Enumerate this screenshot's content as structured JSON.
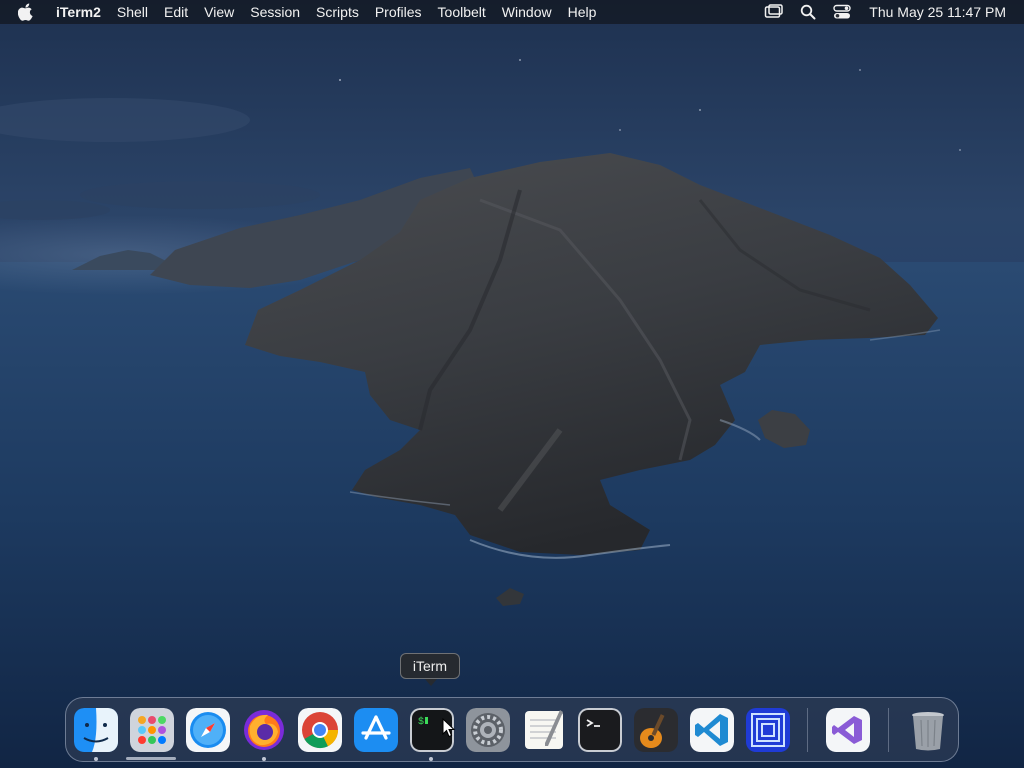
{
  "menubar": {
    "app_name": "iTerm2",
    "items": [
      "Shell",
      "Edit",
      "View",
      "Session",
      "Scripts",
      "Profiles",
      "Toolbelt",
      "Window",
      "Help"
    ],
    "clock": "Thu May 25  11:47 PM",
    "status_icons": [
      "screen-mirroring-icon",
      "spotlight-search-icon",
      "control-center-icon"
    ]
  },
  "dock": {
    "tooltip": "iTerm",
    "apps": [
      {
        "icon": "finder-icon",
        "running": true
      },
      {
        "icon": "launchpad-icon",
        "running": false
      },
      {
        "icon": "safari-icon",
        "running": false
      },
      {
        "icon": "firefox-icon",
        "running": true
      },
      {
        "icon": "chrome-icon",
        "running": false
      },
      {
        "icon": "app-store-icon",
        "running": false
      },
      {
        "icon": "iterm-icon",
        "running": true
      },
      {
        "icon": "system-preferences-icon",
        "running": false
      },
      {
        "icon": "textedit-icon",
        "running": false
      },
      {
        "icon": "terminal-icon",
        "running": false
      },
      {
        "icon": "garageband-icon",
        "running": false
      },
      {
        "icon": "vscode-icon",
        "running": false
      },
      {
        "icon": "maze-app-icon",
        "running": false
      },
      {
        "icon": "visual-studio-icon",
        "running": false
      },
      {
        "icon": "trash-icon",
        "running": false
      }
    ]
  },
  "colors": {
    "sky": "#2b4468",
    "sea": "#1f3a5f",
    "island": "#3b3f44",
    "dock_bg": "#34425a"
  }
}
